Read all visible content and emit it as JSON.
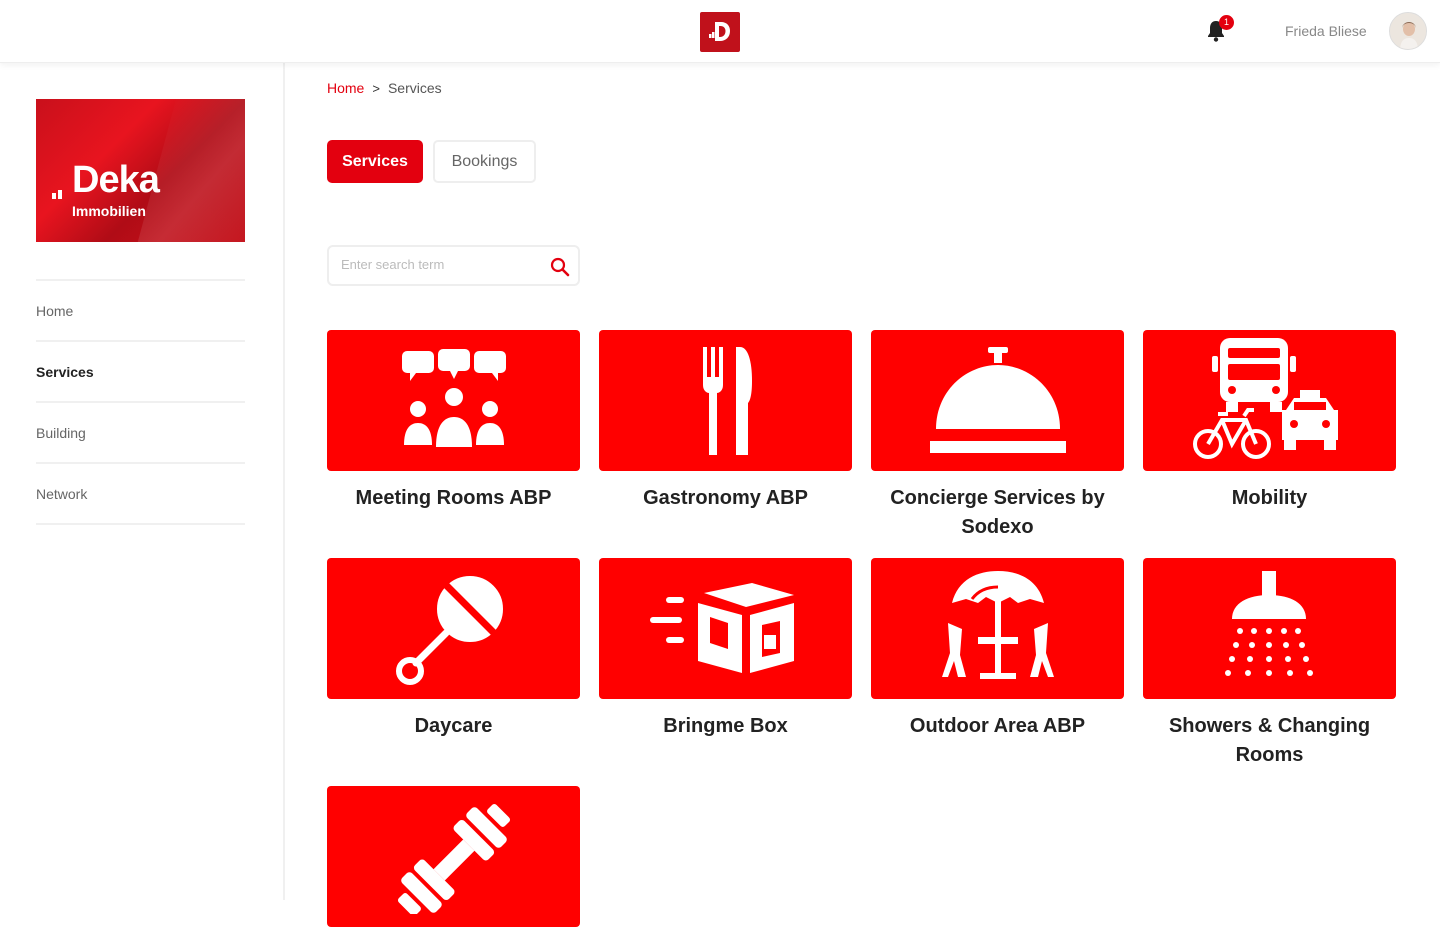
{
  "header": {
    "logo_icon": "deka-app-logo",
    "notification_count": "1",
    "user_name": "Frieda Bliese"
  },
  "sidebar": {
    "brand": {
      "name": "Deka",
      "subtitle": "Immobilien"
    },
    "items": [
      {
        "label": "Home",
        "active": false
      },
      {
        "label": "Services",
        "active": true
      },
      {
        "label": "Building",
        "active": false
      },
      {
        "label": "Network",
        "active": false
      }
    ]
  },
  "breadcrumb": {
    "home": "Home",
    "separator": ">",
    "current": "Services"
  },
  "tabs": [
    {
      "label": "Services",
      "active": true
    },
    {
      "label": "Bookings",
      "active": false
    }
  ],
  "search": {
    "placeholder": "Enter search term",
    "value": ""
  },
  "services": [
    {
      "label": "Meeting Rooms ABP",
      "icon": "meeting-group-icon"
    },
    {
      "label": "Gastronomy ABP",
      "icon": "fork-knife-icon"
    },
    {
      "label": "Concierge Services by Sodexo",
      "icon": "service-bell-icon"
    },
    {
      "label": "Mobility",
      "icon": "bus-bike-taxi-icon"
    },
    {
      "label": "Daycare",
      "icon": "rattle-icon"
    },
    {
      "label": "Bringme Box",
      "icon": "delivery-box-icon"
    },
    {
      "label": "Outdoor Area ABP",
      "icon": "patio-umbrella-icon"
    },
    {
      "label": "Showers & Changing Rooms",
      "icon": "shower-icon"
    },
    {
      "label": "",
      "icon": "dumbbell-icon"
    }
  ],
  "colors": {
    "accent": "#e3000f",
    "tile": "#ff0000",
    "brand_red": "#c9101b"
  }
}
